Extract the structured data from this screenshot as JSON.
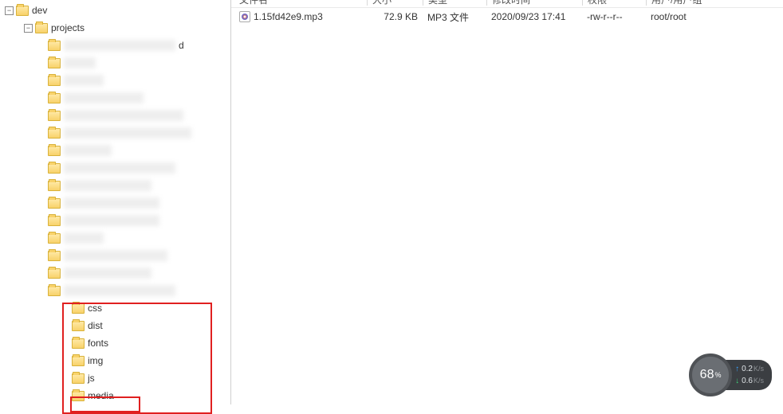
{
  "tree": {
    "root": {
      "name": "dev"
    },
    "child": {
      "name": "projects"
    },
    "subfolders": [
      {
        "name": "css"
      },
      {
        "name": "dist"
      },
      {
        "name": "fonts"
      },
      {
        "name": "img"
      },
      {
        "name": "js"
      },
      {
        "name": "media"
      }
    ]
  },
  "columns": {
    "name": "文件名",
    "size": "大小",
    "type": "类型",
    "modified": "修改时间",
    "perm": "权限",
    "owner": "用户/用户组"
  },
  "files": [
    {
      "name": "1.15fd42e9.mp3",
      "size": "72.9 KB",
      "type": "MP3 文件",
      "modified": "2020/09/23 17:41",
      "perm": "-rw-r--r--",
      "owner": "root/root"
    }
  ],
  "widget": {
    "percent": "68",
    "percent_symbol": "%",
    "up_speed": "0.2",
    "down_speed": "0.6",
    "unit": "K/s"
  }
}
